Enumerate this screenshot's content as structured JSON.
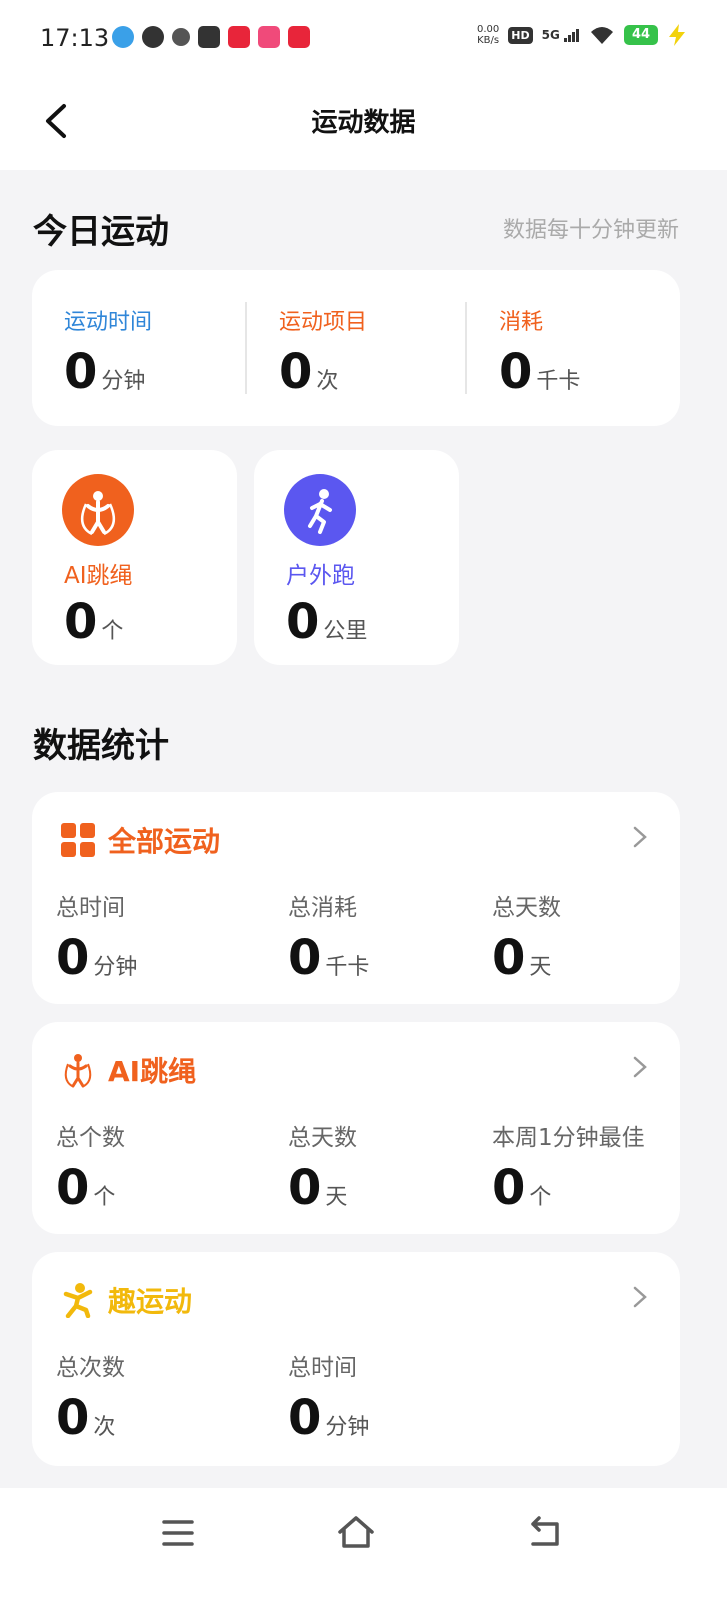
{
  "status_bar": {
    "time": "17:13",
    "net_speed_value": "0.00",
    "net_speed_unit": "KB/s",
    "hd": "HD",
    "signal": "5G",
    "battery": "44"
  },
  "header": {
    "title": "运动数据"
  },
  "today": {
    "title": "今日运动",
    "note": "数据每十分钟更新",
    "summary": [
      {
        "label": "运动时间",
        "value": "0",
        "unit": "分钟",
        "color": "#2f86d8"
      },
      {
        "label": "运动项目",
        "value": "0",
        "unit": "次",
        "color": "#f0611e"
      },
      {
        "label": "消耗",
        "value": "0",
        "unit": "千卡",
        "color": "#f0611e"
      }
    ],
    "activities": [
      {
        "label": "AI跳绳",
        "value": "0",
        "unit": "个",
        "color": "#f0611e",
        "icon": "jump-rope-icon"
      },
      {
        "label": "户外跑",
        "value": "0",
        "unit": "公里",
        "color": "#5b57f0",
        "icon": "runner-icon"
      }
    ]
  },
  "stats": {
    "title": "数据统计",
    "cards": [
      {
        "title": "全部运动",
        "color": "#f0611e",
        "icon": "grid-icon",
        "items": [
          {
            "label": "总时间",
            "value": "0",
            "unit": "分钟"
          },
          {
            "label": "总消耗",
            "value": "0",
            "unit": "千卡"
          },
          {
            "label": "总天数",
            "value": "0",
            "unit": "天"
          }
        ]
      },
      {
        "title": "AI跳绳",
        "color": "#f0611e",
        "icon": "jump-rope-icon",
        "items": [
          {
            "label": "总个数",
            "value": "0",
            "unit": "个"
          },
          {
            "label": "总天数",
            "value": "0",
            "unit": "天"
          },
          {
            "label": "本周1分钟最佳",
            "value": "0",
            "unit": "个"
          }
        ]
      },
      {
        "title": "趣运动",
        "color": "#f2b90c",
        "icon": "fun-exercise-icon",
        "items": [
          {
            "label": "总次数",
            "value": "0",
            "unit": "次"
          },
          {
            "label": "总时间",
            "value": "0",
            "unit": "分钟"
          }
        ]
      }
    ]
  },
  "bottom_nav": [
    "menu-icon",
    "home-icon",
    "back-icon"
  ]
}
